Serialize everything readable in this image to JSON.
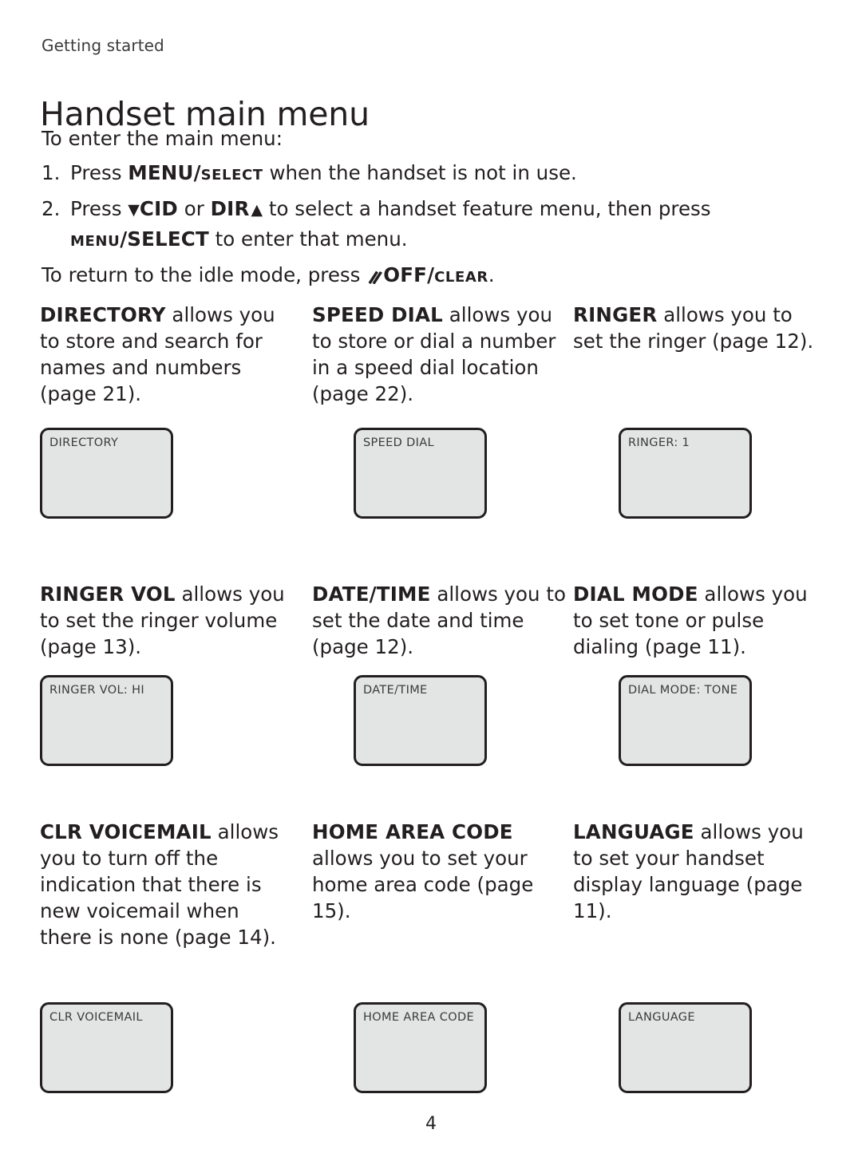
{
  "running_header": "Getting started",
  "page_title": "Handset main menu",
  "intro": {
    "lead": "To enter the main menu:",
    "step1": {
      "number": "1.",
      "pre": "Press ",
      "key_big": "MENU",
      "key_slash": "/",
      "key_small": "SELECT",
      "post": " when the handset is not in use."
    },
    "step2": {
      "number": "2.",
      "pre": "Press ",
      "arrow_down": "▼",
      "key_cid": "CID",
      "mid": " or ",
      "key_dir": "DIR",
      "arrow_up": "▲",
      "post": " to select a handset feature menu, then press",
      "cont_key_small": "MENU",
      "cont_slash": "/",
      "cont_key_big": "SELECT",
      "cont_post": " to enter that menu."
    },
    "closing": {
      "pre": "To return to the idle mode, press ",
      "icon": "off-hook-phone-icon",
      "key_big": "OFF",
      "key_slash": "/",
      "key_small": "CLEAR",
      "post": "."
    }
  },
  "features": [
    [
      {
        "name": "DIRECTORY",
        "desc": " allows you to store and search for names and numbers (page 21).",
        "lcd_text": "DIRECTORY",
        "lcd_indent": 0
      },
      {
        "name": "SPEED DIAL",
        "desc": " allows you to store or dial a number in a speed dial location (page 22).",
        "lcd_text": "SPEED DIAL",
        "lcd_indent": 52
      },
      {
        "name": "RINGER",
        "desc": " allows you to set the ringer (page 12).",
        "lcd_text": "RINGER: 1",
        "lcd_indent": 57
      }
    ],
    [
      {
        "name": "RINGER VOL",
        "desc": " allows you to set the ringer volume (page 13).",
        "lcd_text": "RINGER VOL: HI",
        "lcd_indent": 0
      },
      {
        "name": "DATE/TIME",
        "desc": " allows you to set the date and time (page 12).",
        "lcd_text": "DATE/TIME",
        "lcd_indent": 52
      },
      {
        "name": "DIAL MODE",
        "desc": " allows you to set tone or pulse dialing (page 11).",
        "lcd_text": "DIAL MODE: TONE",
        "lcd_indent": 57
      }
    ],
    [
      {
        "name": "CLR VOICEMAIL",
        "desc": " allows you to turn off the indication that there is new voicemail when there is none (page 14).",
        "lcd_text": "CLR VOICEMAIL",
        "lcd_indent": 0
      },
      {
        "name": "HOME AREA CODE",
        "desc": " allows you to set your home area code (page 15).",
        "lcd_text": "HOME AREA CODE",
        "lcd_indent": 52
      },
      {
        "name": "LANGUAGE",
        "desc": " allows you to set your handset display language (page 11).",
        "lcd_text": "LANGUAGE",
        "lcd_indent": 57
      }
    ]
  ],
  "row_tops": [
    0,
    350,
    648
  ],
  "lcd_tops": [
    158,
    118,
    230
  ],
  "folio": "4",
  "colors": {
    "text": "#231f20",
    "header_text": "#3b3b3b",
    "lcd_fill": "#e3e5e5",
    "lcd_border": "#231f20",
    "lcd_text": "#3a3a3a"
  }
}
